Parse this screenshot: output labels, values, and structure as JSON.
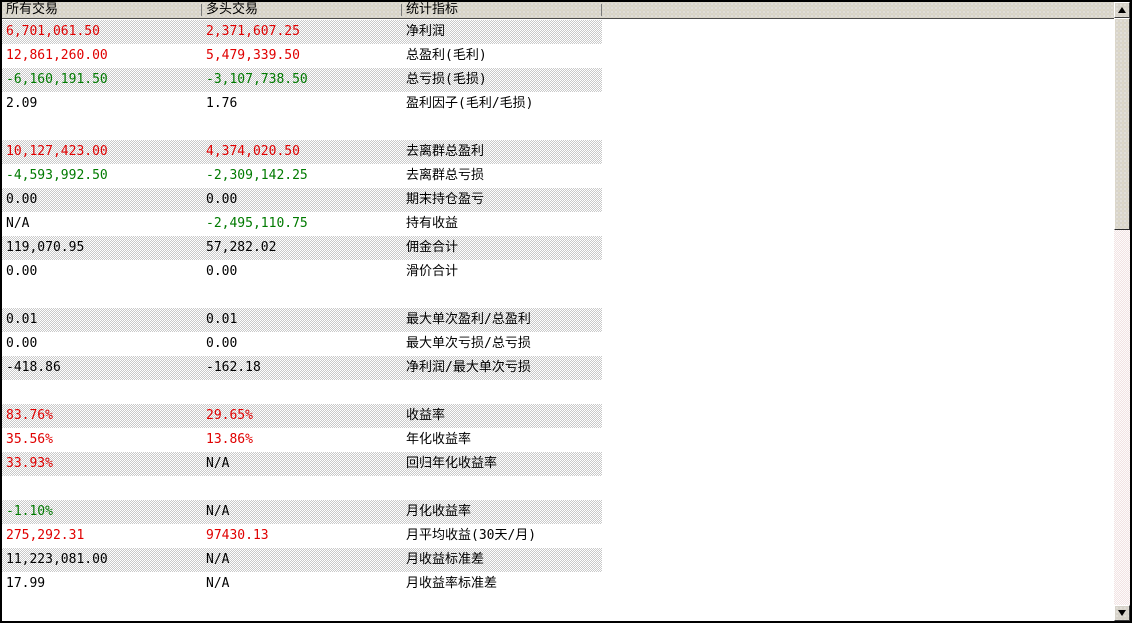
{
  "header": {
    "columns": [
      {
        "label": "所有交易"
      },
      {
        "label": "多头交易"
      },
      {
        "label": "统计指标"
      }
    ]
  },
  "colors": {
    "red": "#e00000",
    "green": "#007a00",
    "black": "#000000",
    "header_bg": "#d6d2c9",
    "stripe": "#c9c9c9",
    "window_border": "#000000"
  },
  "icons": {
    "up_arrow": "▲",
    "down_arrow": "▼"
  },
  "table": {
    "groups": [
      {
        "rows": [
          {
            "all": {
              "text": "6,701,061.50",
              "color": "red"
            },
            "long": {
              "text": "2,371,607.25",
              "color": "red"
            },
            "metric": "净利润"
          },
          {
            "all": {
              "text": "12,861,260.00",
              "color": "red"
            },
            "long": {
              "text": "5,479,339.50",
              "color": "red"
            },
            "metric": "总盈利(毛利)"
          },
          {
            "all": {
              "text": "-6,160,191.50",
              "color": "green"
            },
            "long": {
              "text": "-3,107,738.50",
              "color": "green"
            },
            "metric": "总亏损(毛损)"
          },
          {
            "all": {
              "text": "2.09",
              "color": "black"
            },
            "long": {
              "text": "1.76",
              "color": "black"
            },
            "metric": "盈利因子(毛利/毛损)"
          }
        ]
      },
      {
        "rows": [
          {
            "all": {
              "text": "10,127,423.00",
              "color": "red"
            },
            "long": {
              "text": "4,374,020.50",
              "color": "red"
            },
            "metric": "去离群总盈利"
          },
          {
            "all": {
              "text": "-4,593,992.50",
              "color": "green"
            },
            "long": {
              "text": "-2,309,142.25",
              "color": "green"
            },
            "metric": "去离群总亏损"
          },
          {
            "all": {
              "text": "0.00",
              "color": "black"
            },
            "long": {
              "text": "0.00",
              "color": "black"
            },
            "metric": "期末持仓盈亏"
          },
          {
            "all": {
              "text": "N/A",
              "color": "black"
            },
            "long": {
              "text": "-2,495,110.75",
              "color": "green"
            },
            "metric": "持有收益"
          },
          {
            "all": {
              "text": "119,070.95",
              "color": "black"
            },
            "long": {
              "text": "57,282.02",
              "color": "black"
            },
            "metric": "佣金合计"
          },
          {
            "all": {
              "text": "0.00",
              "color": "black"
            },
            "long": {
              "text": "0.00",
              "color": "black"
            },
            "metric": "滑价合计"
          }
        ]
      },
      {
        "rows": [
          {
            "all": {
              "text": "0.01",
              "color": "black"
            },
            "long": {
              "text": "0.01",
              "color": "black"
            },
            "metric": "最大单次盈利/总盈利"
          },
          {
            "all": {
              "text": "0.00",
              "color": "black"
            },
            "long": {
              "text": "0.00",
              "color": "black"
            },
            "metric": "最大单次亏损/总亏损"
          },
          {
            "all": {
              "text": "-418.86",
              "color": "black"
            },
            "long": {
              "text": "-162.18",
              "color": "black"
            },
            "metric": "净利润/最大单次亏损"
          }
        ]
      },
      {
        "rows": [
          {
            "all": {
              "text": "83.76%",
              "color": "red"
            },
            "long": {
              "text": "29.65%",
              "color": "red"
            },
            "metric": "收益率"
          },
          {
            "all": {
              "text": "35.56%",
              "color": "red"
            },
            "long": {
              "text": "13.86%",
              "color": "red"
            },
            "metric": "年化收益率"
          },
          {
            "all": {
              "text": "33.93%",
              "color": "red"
            },
            "long": {
              "text": "N/A",
              "color": "black"
            },
            "metric": "回归年化收益率"
          }
        ]
      },
      {
        "rows": [
          {
            "all": {
              "text": "-1.10%",
              "color": "green"
            },
            "long": {
              "text": "N/A",
              "color": "black"
            },
            "metric": "月化收益率"
          },
          {
            "all": {
              "text": "275,292.31",
              "color": "red"
            },
            "long": {
              "text": "97430.13",
              "color": "red"
            },
            "metric": "月平均收益(30天/月)"
          },
          {
            "all": {
              "text": "11,223,081.00",
              "color": "black"
            },
            "long": {
              "text": "N/A",
              "color": "black"
            },
            "metric": "月收益标准差"
          },
          {
            "all": {
              "text": "17.99",
              "color": "black"
            },
            "long": {
              "text": "N/A",
              "color": "black"
            },
            "metric": "月收益率标准差"
          }
        ]
      }
    ]
  }
}
